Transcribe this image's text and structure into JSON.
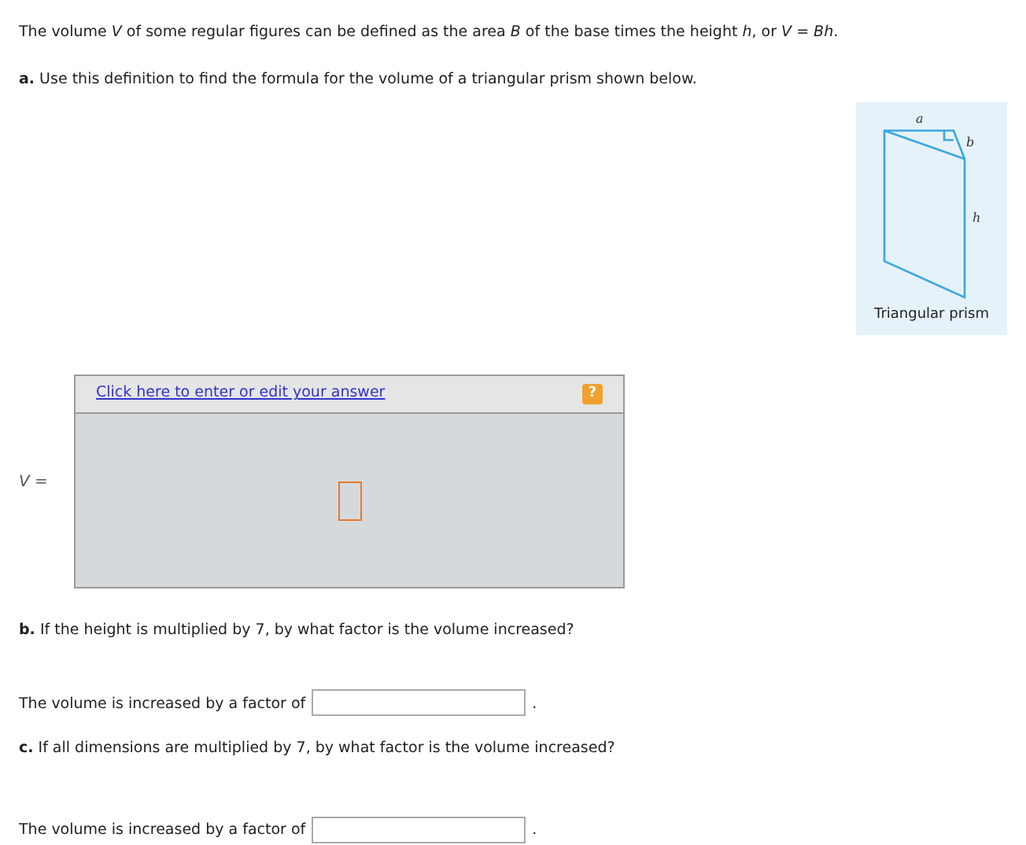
{
  "intro": "The volume *V* of some regular figures can be defined as the area *B* of the base times the height *h*, or *V* = *Bh*.",
  "part_a": {
    "text": "**a.** Use this definition to find the formula for the volume of a triangular prism shown below.",
    "figure": {
      "label_a": "a",
      "label_b": "b",
      "label_h": "h",
      "caption": "Triangular prism"
    },
    "answer": {
      "label": "*V* =",
      "link": "Click here to enter or edit your answer",
      "help": "?"
    }
  },
  "parts": [
    {
      "question": "**b.** If the height is multiplied by 7, by what factor is the volume increased?",
      "answer_prefix": "The volume is increased by a factor of",
      "suffix": "."
    },
    {
      "question": "**c.** If all dimensions are multiplied by 7, by what factor is the volume increased?",
      "answer_prefix": "The volume is increased by a factor of",
      "suffix": "."
    }
  ]
}
